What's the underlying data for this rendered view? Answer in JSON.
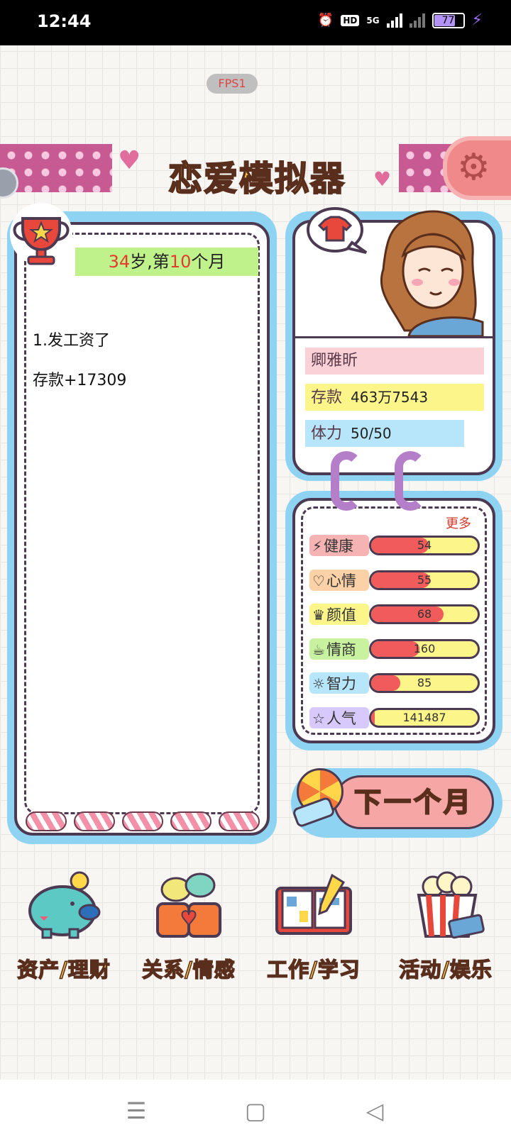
{
  "status_bar": {
    "time": "12:44",
    "hd_label": "HD",
    "network_label": "5G",
    "battery": "77"
  },
  "fps": "FPS1",
  "banner": {
    "title": "恋爱模拟器"
  },
  "log": {
    "age_number": "34",
    "age_suffix": "岁,第",
    "month_number": "10",
    "month_suffix": "个月",
    "event_title": "1.发工资了",
    "event_detail": "存款+17309"
  },
  "profile": {
    "name": "卿雅昕",
    "savings_label": "存款",
    "savings_value": "463万7543",
    "stamina_label": "体力",
    "stamina_value": "50/50"
  },
  "stats": {
    "more_label": "更多",
    "items": [
      {
        "label": "健康",
        "icon": "lightning-icon",
        "value": "54",
        "fill": 0.54,
        "color": "#f6b3b3"
      },
      {
        "label": "心情",
        "icon": "heart-outline-icon",
        "value": "55",
        "fill": 0.55,
        "color": "#fbd1a8"
      },
      {
        "label": "颜值",
        "icon": "crown-icon",
        "value": "68",
        "fill": 0.68,
        "color": "#fbf58a"
      },
      {
        "label": "情商",
        "icon": "coffee-cup-icon",
        "value": "160",
        "fill": 0.45,
        "color": "#c9f2a0"
      },
      {
        "label": "智力",
        "icon": "lightbulb-icon",
        "value": "85",
        "fill": 0.27,
        "color": "#b7e6fb"
      },
      {
        "label": "人气",
        "icon": "star-icon",
        "value": "141487",
        "fill": 0.02,
        "color": "#d7c9fb"
      }
    ]
  },
  "next_button": {
    "label": "下一个月"
  },
  "menu": [
    {
      "label": "资产/理财",
      "icon": "piggy-bank-icon"
    },
    {
      "label": "关系/情感",
      "icon": "couple-cups-icon"
    },
    {
      "label": "工作/学习",
      "icon": "open-book-icon"
    },
    {
      "label": "活动/娱乐",
      "icon": "popcorn-icon"
    }
  ],
  "navigation": {
    "menu_glyph": "☰",
    "home_glyph": "▢",
    "back_glyph": "◁"
  }
}
